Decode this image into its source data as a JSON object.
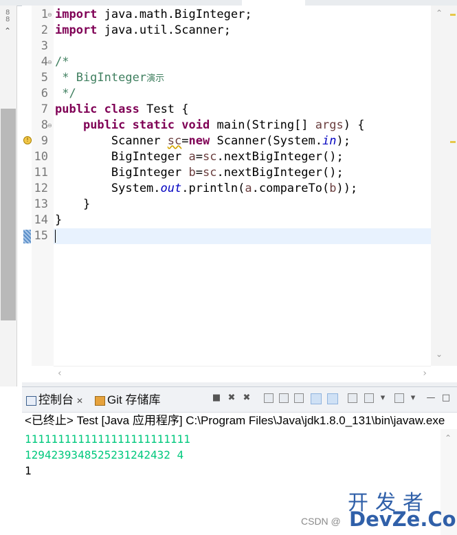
{
  "editor": {
    "line_numbers": [
      "1",
      "2",
      "3",
      "4",
      "5",
      "6",
      "7",
      "8",
      "9",
      "10",
      "11",
      "12",
      "13",
      "14",
      "15"
    ],
    "lines": {
      "l1": {
        "kw": "import",
        "rest": " java.math.BigInteger;"
      },
      "l2": {
        "kw": "import",
        "rest": " java.util.Scanner;"
      },
      "l4": "/*",
      "l5": {
        "prefix": " * BigInteger",
        "cjk": "演示"
      },
      "l6": " */",
      "l7": {
        "kw1": "public",
        "kw2": "class",
        "rest": " Test {"
      },
      "l8": {
        "indent": "    ",
        "kw1": "public",
        "kw2": "static",
        "kw3": "void",
        "pre": " main(String[] ",
        "param": "args",
        "post": ") {"
      },
      "l9": {
        "indent": "        ",
        "type": "Scanner ",
        "var": "sc",
        "eq": "=",
        "kw": "new",
        "mid": " Scanner(System.",
        "field": "in",
        "end": ");"
      },
      "l10": {
        "indent": "        ",
        "type": "BigInteger ",
        "var": "a",
        "eq": "=",
        "v2": "sc",
        "end": ".nextBigInteger();"
      },
      "l11": {
        "indent": "        ",
        "type": "BigInteger ",
        "var": "b",
        "eq": "=",
        "v2": "sc",
        "end": ".nextBigInteger();"
      },
      "l12": {
        "pre": "        System.",
        "field": "out",
        "mid": ".println(",
        "v1": "a",
        "mid2": ".compareTo(",
        "v2": "b",
        "end": "));"
      },
      "l13": "    }",
      "l14": "}"
    }
  },
  "console": {
    "tab_console": "控制台",
    "tab_git": "Git 存储库",
    "close_glyph": "✕",
    "status": "<已终止> Test [Java 应用程序] C:\\Program Files\\Java\\jdk1.8.0_131\\bin\\javaw.exe",
    "output": [
      {
        "text": "1111111111111111111111111",
        "kind": "input"
      },
      {
        "text": "1294239348525231242432 4",
        "kind": "input"
      },
      {
        "text": "1",
        "kind": "output"
      }
    ]
  },
  "watermark": {
    "csdn": "CSDN @",
    "line1": "开发者",
    "line2": "DevZe.CoM"
  },
  "colors": {
    "keyword": "#7f0055",
    "comment": "#3f7f5f",
    "field": "#0000c0",
    "console_input": "#00c87d",
    "line_highlight": "#e8f2fe"
  }
}
